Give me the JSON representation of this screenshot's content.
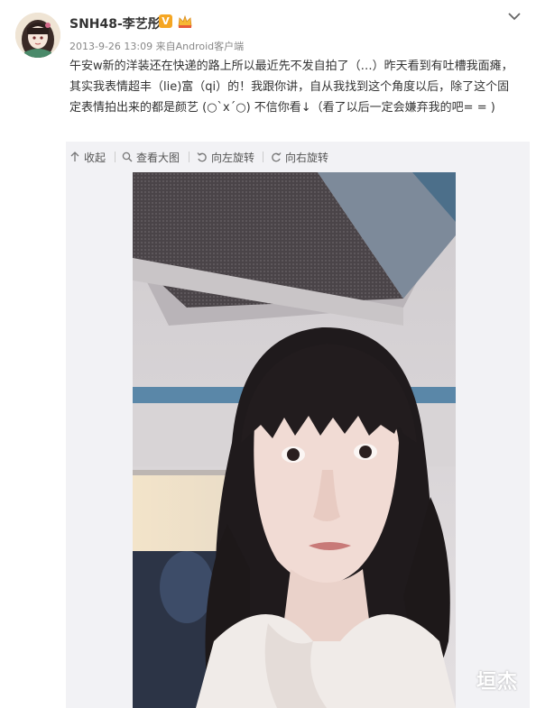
{
  "post": {
    "username": "SNH48-李艺彤",
    "verified_badge": "V",
    "timestamp": "2013-9-26 13:09",
    "source_prefix": "来自",
    "source": "Android客户端",
    "text": "午安w新的洋装还在快递的路上所以最近先不发自拍了（…）昨天看到有吐槽我面瘫，其实我表情超丰（lie)富（qi）的！我跟你讲，自从我找到这个角度以后，除了这个固定表情拍出来的都是颜艺 (○`x´○) 不信你看↓（看了以后一定会嫌弃我的吧= = )"
  },
  "toolbar": {
    "collapse_label": "收起",
    "view_large_label": "查看大图",
    "rotate_left_label": "向左旋转",
    "rotate_right_label": "向右旋转"
  },
  "watermark": "垣杰",
  "colors": {
    "text": "#333333",
    "meta": "#888888",
    "panel_bg": "#f2f2f5",
    "badge": "#f5a623"
  },
  "icons": [
    "chevron-down-icon",
    "arrow-up-icon",
    "search-icon",
    "rotate-left-icon",
    "rotate-right-icon",
    "crown-icon"
  ]
}
